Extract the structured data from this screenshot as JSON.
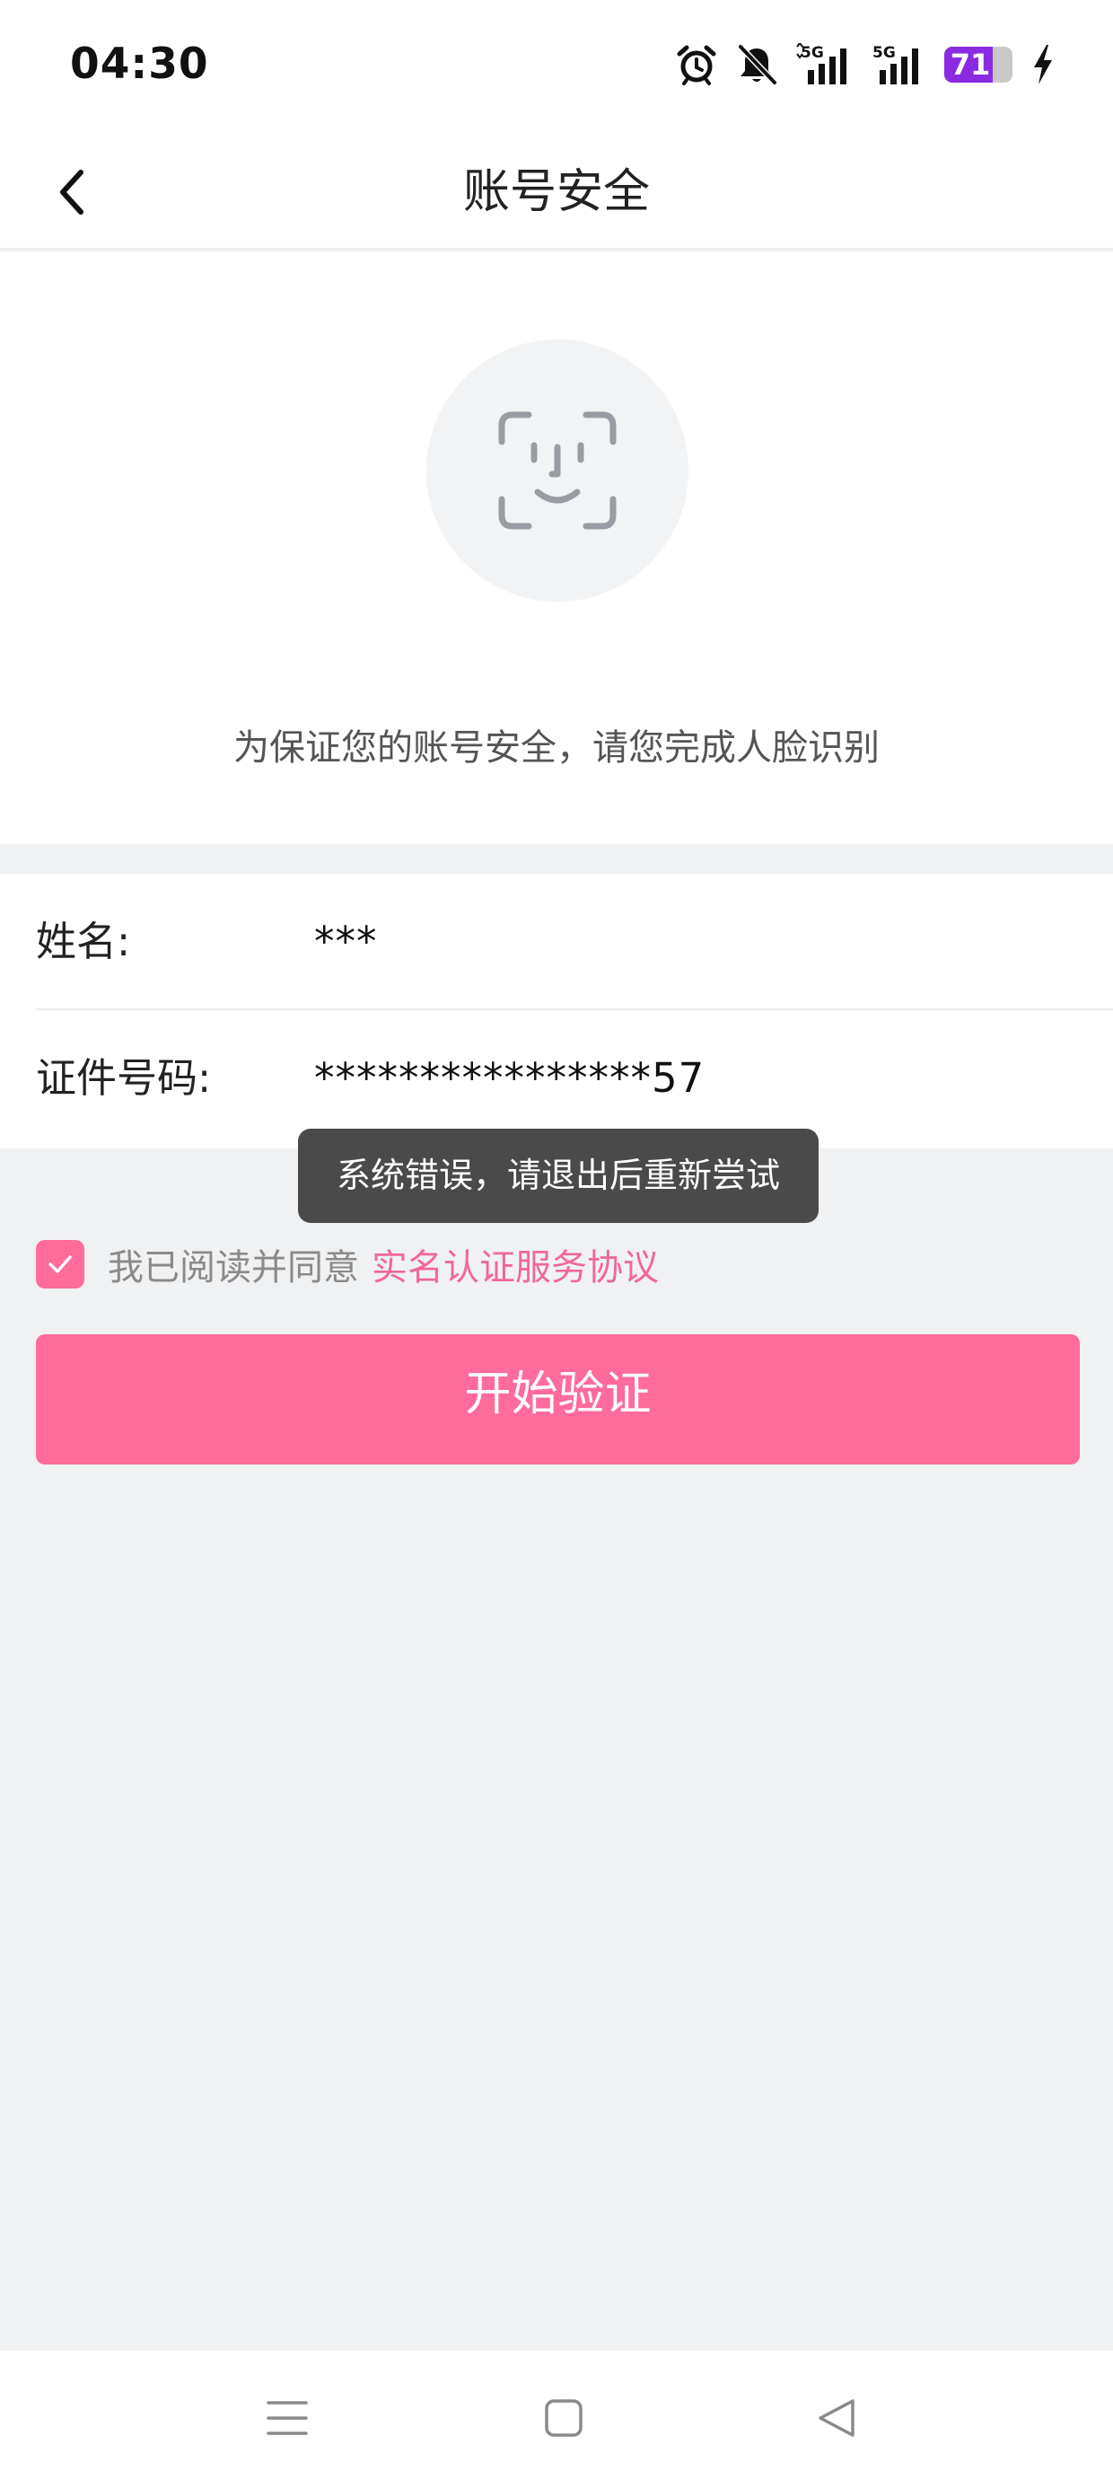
{
  "status_bar": {
    "time": "04:30",
    "icons": [
      "alarm-icon",
      "bell-muted-icon",
      "signal-5g-icon",
      "signal-5g-icon"
    ],
    "signal_1_label": "5G",
    "signal_2_label": "5G",
    "battery_level": 71,
    "battery_text": "71",
    "charging": true,
    "battery_color": "#8a2be2"
  },
  "nav": {
    "back_icon": "chevron-left-icon",
    "title": "账号安全"
  },
  "face": {
    "icon": "face-id-icon",
    "hint": "为保证您的账号安全，请您完成人脸识别"
  },
  "form": {
    "name_label": "姓名:",
    "name_value": "***",
    "id_label": "证件号码:",
    "id_value": "****************57"
  },
  "toast": {
    "message": "系统错误，请退出后重新尝试"
  },
  "agreement": {
    "checked": true,
    "text": "我已阅读并同意",
    "link": "实名认证服务协议"
  },
  "actions": {
    "start_label": "开始验证"
  },
  "colors": {
    "accent": "#ff6b9b",
    "link": "#f0689a",
    "background": "#f0f1f3",
    "toast": "#4a4a4a"
  },
  "system_nav": {
    "icons": [
      "menu-icon",
      "home-icon",
      "back-triangle-icon"
    ]
  }
}
